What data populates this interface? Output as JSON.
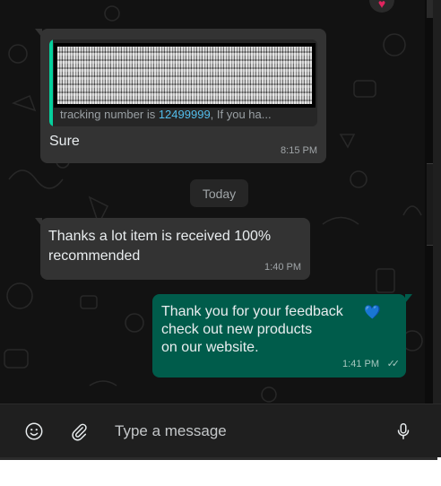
{
  "messages": [
    {
      "direction": "incoming",
      "quoted": {
        "text_prefix": "tracking number is ",
        "text_number": "12499999",
        "text_suffix": ", If you ha...",
        "redacted": true
      },
      "text": "Sure",
      "time": "8:15 PM"
    },
    {
      "direction": "incoming",
      "text": "Thanks a lot item is received 100% recommended",
      "time": "1:40 PM"
    },
    {
      "direction": "outgoing",
      "text": "Thank you for your feedback\ncheck out new products\non our website.",
      "emoji": "💙",
      "time": "1:41 PM",
      "status": "read"
    }
  ],
  "day_divider": "Today",
  "composer": {
    "placeholder": "Type a message",
    "emoji_icon": "smiley-icon",
    "attach_icon": "paperclip-icon",
    "mic_icon": "microphone-icon"
  },
  "colors": {
    "incoming_bubble": "#333333",
    "outgoing_bubble": "#005c4b",
    "chat_background": "#121212",
    "quote_accent": "#06cf9c"
  }
}
